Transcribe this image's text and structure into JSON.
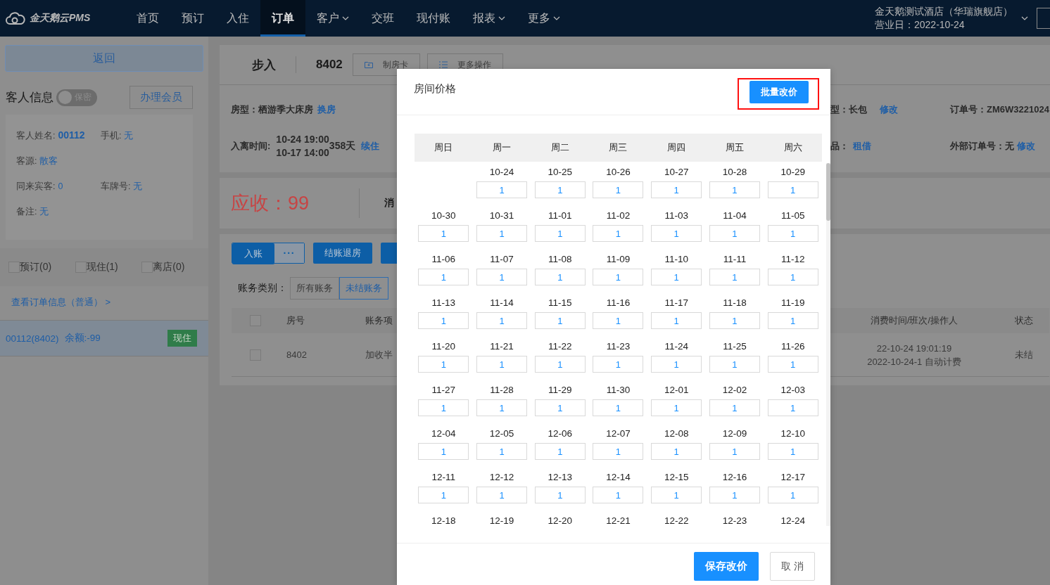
{
  "nav": {
    "logo": "金天鹅云PMS",
    "items": [
      {
        "label": "首页",
        "selected": false,
        "has_menu": false
      },
      {
        "label": "预订",
        "selected": false,
        "has_menu": false
      },
      {
        "label": "入住",
        "selected": false,
        "has_menu": false
      },
      {
        "label": "订单",
        "selected": true,
        "has_menu": false
      },
      {
        "label": "客户",
        "selected": false,
        "has_menu": true
      },
      {
        "label": "交班",
        "selected": false,
        "has_menu": false
      },
      {
        "label": "现付账",
        "selected": false,
        "has_menu": false
      },
      {
        "label": "报表",
        "selected": false,
        "has_menu": true
      },
      {
        "label": "更多",
        "selected": false,
        "has_menu": true
      }
    ],
    "hotel": "金天鹅测试酒店（华瑞旗舰店）",
    "business_day": "营业日：2022-10-24"
  },
  "sidebar": {
    "back": "返回",
    "guest_title": "客人信息",
    "privacy_toggle": {
      "label": "保密",
      "on": false
    },
    "member_button": "办理会员",
    "field_rows": [
      [
        {
          "label": "客人姓名:",
          "value": "00112",
          "strong": true
        },
        {
          "label": "手机:",
          "value": "无",
          "strong": false
        }
      ],
      [
        {
          "label": "客源:",
          "value": "散客",
          "strong": false
        }
      ],
      [
        {
          "label": "同来宾客:",
          "value": "0",
          "strong": false
        },
        {
          "label": "车牌号:",
          "value": "无",
          "strong": false
        }
      ],
      [
        {
          "label": "备注:",
          "value": "无",
          "strong": false
        }
      ]
    ],
    "filters": [
      {
        "label": "预订(0)",
        "checked": false
      },
      {
        "label": "现住(1)",
        "checked": false
      },
      {
        "label": "离店(0)",
        "checked": false
      }
    ],
    "order_link": "查看订单信息（普通） >",
    "orders": [
      {
        "name": "00112(8402)",
        "balance": "余额:-99",
        "status": "现住",
        "selected": true
      }
    ]
  },
  "order_header": {
    "source": "步入",
    "room": "8402",
    "actions": [
      {
        "label": "制房卡",
        "kind": "folder"
      },
      {
        "label": "更多操作",
        "kind": "list"
      }
    ]
  },
  "order_info": {
    "room_type": {
      "label": "房型：",
      "value": "栖游季大床房",
      "action": "换房"
    },
    "stay": {
      "label": "入离时间:",
      "arrive": "10-24 19:00",
      "depart": "10-17 14:00",
      "nights": "358天",
      "action": "续住"
    },
    "right_rows": [
      {
        "field": {
          "label": "型：",
          "value": "长包",
          "action": "修改"
        },
        "number": {
          "label": "订单号：",
          "value": "ZM6W3221024"
        }
      },
      {
        "field": {
          "label": "品：",
          "action": "租借"
        },
        "number": {
          "label": "外部订单号：",
          "value": "无",
          "action": "修改"
        }
      }
    ]
  },
  "receivable": {
    "label": "应收：",
    "amount": "99",
    "next_label": "消"
  },
  "account": {
    "buttons": [
      {
        "label": "入账",
        "kind": "split",
        "menu": "···"
      },
      {
        "label": "结账退房",
        "kind": "plain"
      },
      {
        "kind": "plain"
      }
    ],
    "category_label": "账务类别：",
    "categories": [
      {
        "label": "所有账务",
        "selected": false
      },
      {
        "label": "未结账务",
        "selected": true
      }
    ],
    "table": {
      "all_checked": false,
      "columns": [
        "房号",
        "账务项",
        "消费时间/班次/操作人",
        "状态"
      ],
      "rows": [
        {
          "checked": false,
          "room": "8402",
          "item": "加收半",
          "time": "22-10-24 19:01:19",
          "shift": "2022-10-24-1 自动计费",
          "status": "未结"
        }
      ]
    }
  },
  "modal": {
    "title": "房间价格",
    "batch_button": "批量改价",
    "weekdays": [
      "周日",
      "周一",
      "周二",
      "周三",
      "周四",
      "周五",
      "周六"
    ],
    "weeks": [
      [
        {
          "date": "10-24",
          "price": "1"
        },
        {
          "date": "10-25",
          "price": "1"
        },
        {
          "date": "10-26",
          "price": "1"
        },
        {
          "date": "10-27",
          "price": "1"
        },
        {
          "date": "10-28",
          "price": "1"
        },
        {
          "date": "10-29",
          "price": "1"
        }
      ],
      [
        {
          "date": "10-30",
          "price": "1"
        },
        {
          "date": "10-31",
          "price": "1"
        },
        {
          "date": "11-01",
          "price": "1"
        },
        {
          "date": "11-02",
          "price": "1"
        },
        {
          "date": "11-03",
          "price": "1"
        },
        {
          "date": "11-04",
          "price": "1"
        },
        {
          "date": "11-05",
          "price": "1"
        }
      ],
      [
        {
          "date": "11-06",
          "price": "1"
        },
        {
          "date": "11-07",
          "price": "1"
        },
        {
          "date": "11-08",
          "price": "1"
        },
        {
          "date": "11-09",
          "price": "1"
        },
        {
          "date": "11-10",
          "price": "1"
        },
        {
          "date": "11-11",
          "price": "1"
        },
        {
          "date": "11-12",
          "price": "1"
        }
      ],
      [
        {
          "date": "11-13",
          "price": "1"
        },
        {
          "date": "11-14",
          "price": "1"
        },
        {
          "date": "11-15",
          "price": "1"
        },
        {
          "date": "11-16",
          "price": "1"
        },
        {
          "date": "11-17",
          "price": "1"
        },
        {
          "date": "11-18",
          "price": "1"
        },
        {
          "date": "11-19",
          "price": "1"
        }
      ],
      [
        {
          "date": "11-20",
          "price": "1"
        },
        {
          "date": "11-21",
          "price": "1"
        },
        {
          "date": "11-22",
          "price": "1"
        },
        {
          "date": "11-23",
          "price": "1"
        },
        {
          "date": "11-24",
          "price": "1"
        },
        {
          "date": "11-25",
          "price": "1"
        },
        {
          "date": "11-26",
          "price": "1"
        }
      ],
      [
        {
          "date": "11-27",
          "price": "1"
        },
        {
          "date": "11-28",
          "price": "1"
        },
        {
          "date": "11-29",
          "price": "1"
        },
        {
          "date": "11-30",
          "price": "1"
        },
        {
          "date": "12-01",
          "price": "1"
        },
        {
          "date": "12-02",
          "price": "1"
        },
        {
          "date": "12-03",
          "price": "1"
        }
      ],
      [
        {
          "date": "12-04",
          "price": "1"
        },
        {
          "date": "12-05",
          "price": "1"
        },
        {
          "date": "12-06",
          "price": "1"
        },
        {
          "date": "12-07",
          "price": "1"
        },
        {
          "date": "12-08",
          "price": "1"
        },
        {
          "date": "12-09",
          "price": "1"
        },
        {
          "date": "12-10",
          "price": "1"
        }
      ],
      [
        {
          "date": "12-11",
          "price": "1"
        },
        {
          "date": "12-12",
          "price": "1"
        },
        {
          "date": "12-13",
          "price": "1"
        },
        {
          "date": "12-14",
          "price": "1"
        },
        {
          "date": "12-15",
          "price": "1"
        },
        {
          "date": "12-16",
          "price": "1"
        },
        {
          "date": "12-17",
          "price": "1"
        }
      ],
      [
        {
          "date": "12-18"
        },
        {
          "date": "12-19"
        },
        {
          "date": "12-20"
        },
        {
          "date": "12-21"
        },
        {
          "date": "12-22"
        },
        {
          "date": "12-23"
        },
        {
          "date": "12-24"
        }
      ]
    ],
    "save": "保存改价",
    "cancel": "取 消"
  }
}
